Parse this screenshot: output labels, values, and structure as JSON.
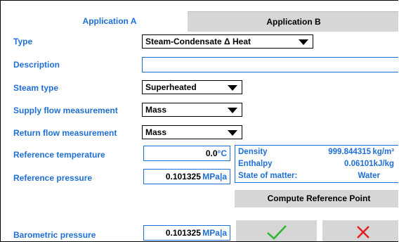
{
  "tabs": [
    {
      "label": "Application A",
      "active": true
    },
    {
      "label": "Application B",
      "active": false
    }
  ],
  "form": {
    "type": {
      "label": "Type",
      "value": "Steam-Condensate Δ Heat"
    },
    "description": {
      "label": "Description",
      "value": ""
    },
    "steam_type": {
      "label": "Steam type",
      "value": "Superheated"
    },
    "supply_flow": {
      "label": "Supply flow measurement",
      "value": "Mass"
    },
    "return_flow": {
      "label": "Return flow measurement",
      "value": "Mass"
    },
    "reference_temperature": {
      "label": "Reference temperature",
      "value": "0.0",
      "unit": "°C"
    },
    "reference_pressure": {
      "label": "Reference pressure",
      "value": "0.101325",
      "unit": "MPa|a"
    },
    "barometric_pressure": {
      "label": "Barometric pressure",
      "value": "0.101325",
      "unit": "MPa|a"
    }
  },
  "reference_point": {
    "density": {
      "label": "Density",
      "value": "999.844315",
      "unit": "kg/m³"
    },
    "enthalpy": {
      "label": "Enthalpy",
      "value": "0.06101",
      "unit": "kJ/kg"
    },
    "state": {
      "label": "State of matter:",
      "value": "Water"
    }
  },
  "buttons": {
    "compute": "Compute Reference Point",
    "confirm_icon": "checkmark-icon",
    "cancel_icon": "close-icon"
  },
  "colors": {
    "accent": "#1f6fd6",
    "button_bg": "#d6d6d6",
    "confirm": "#2db52d",
    "cancel": "#e02020"
  }
}
